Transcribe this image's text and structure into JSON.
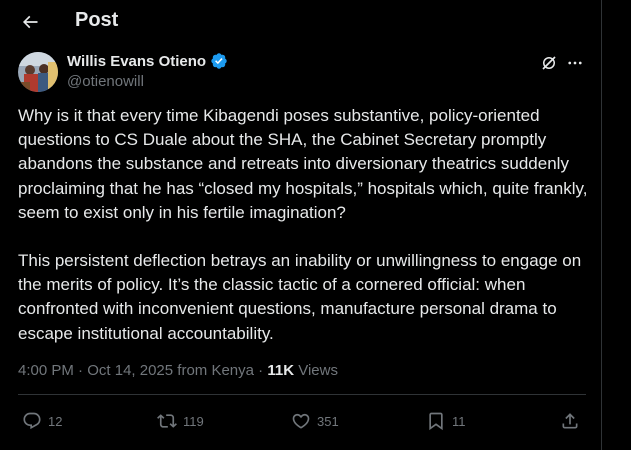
{
  "header": {
    "title": "Post",
    "back_icon": "arrow-left-icon"
  },
  "author": {
    "name": "Willis Evans Otieno",
    "handle": "@otienowill",
    "verified": true,
    "verified_color": "#1d9bf0"
  },
  "tweet": {
    "paragraphs": [
      "Why is it that every time Kibagendi poses substantive, policy-oriented questions to CS Duale about the SHA, the Cabinet Secretary promptly abandons the substance and retreats into diversionary theatrics suddenly proclaiming that he has “closed my hospitals,” hospitals which, quite frankly, seem to exist only in his fertile imagination?",
      "This persistent deflection betrays an inability or unwillingness to engage on the merits of policy. It’s the classic tactic of a cornered official: when confronted with inconvenient questions, manufacture personal drama to escape institutional accountability."
    ]
  },
  "meta": {
    "time": "4:00 PM",
    "separator": " · ",
    "date": "Oct 14, 2025",
    "location": " from Kenya",
    "views_count": "11K",
    "views_label": " Views"
  },
  "actions": {
    "replies": "12",
    "reposts": "119",
    "likes": "351",
    "bookmarks": "11"
  },
  "colors": {
    "background": "#000000",
    "text": "#e7e9ea",
    "secondary": "#71767b",
    "border": "#2f3336"
  }
}
